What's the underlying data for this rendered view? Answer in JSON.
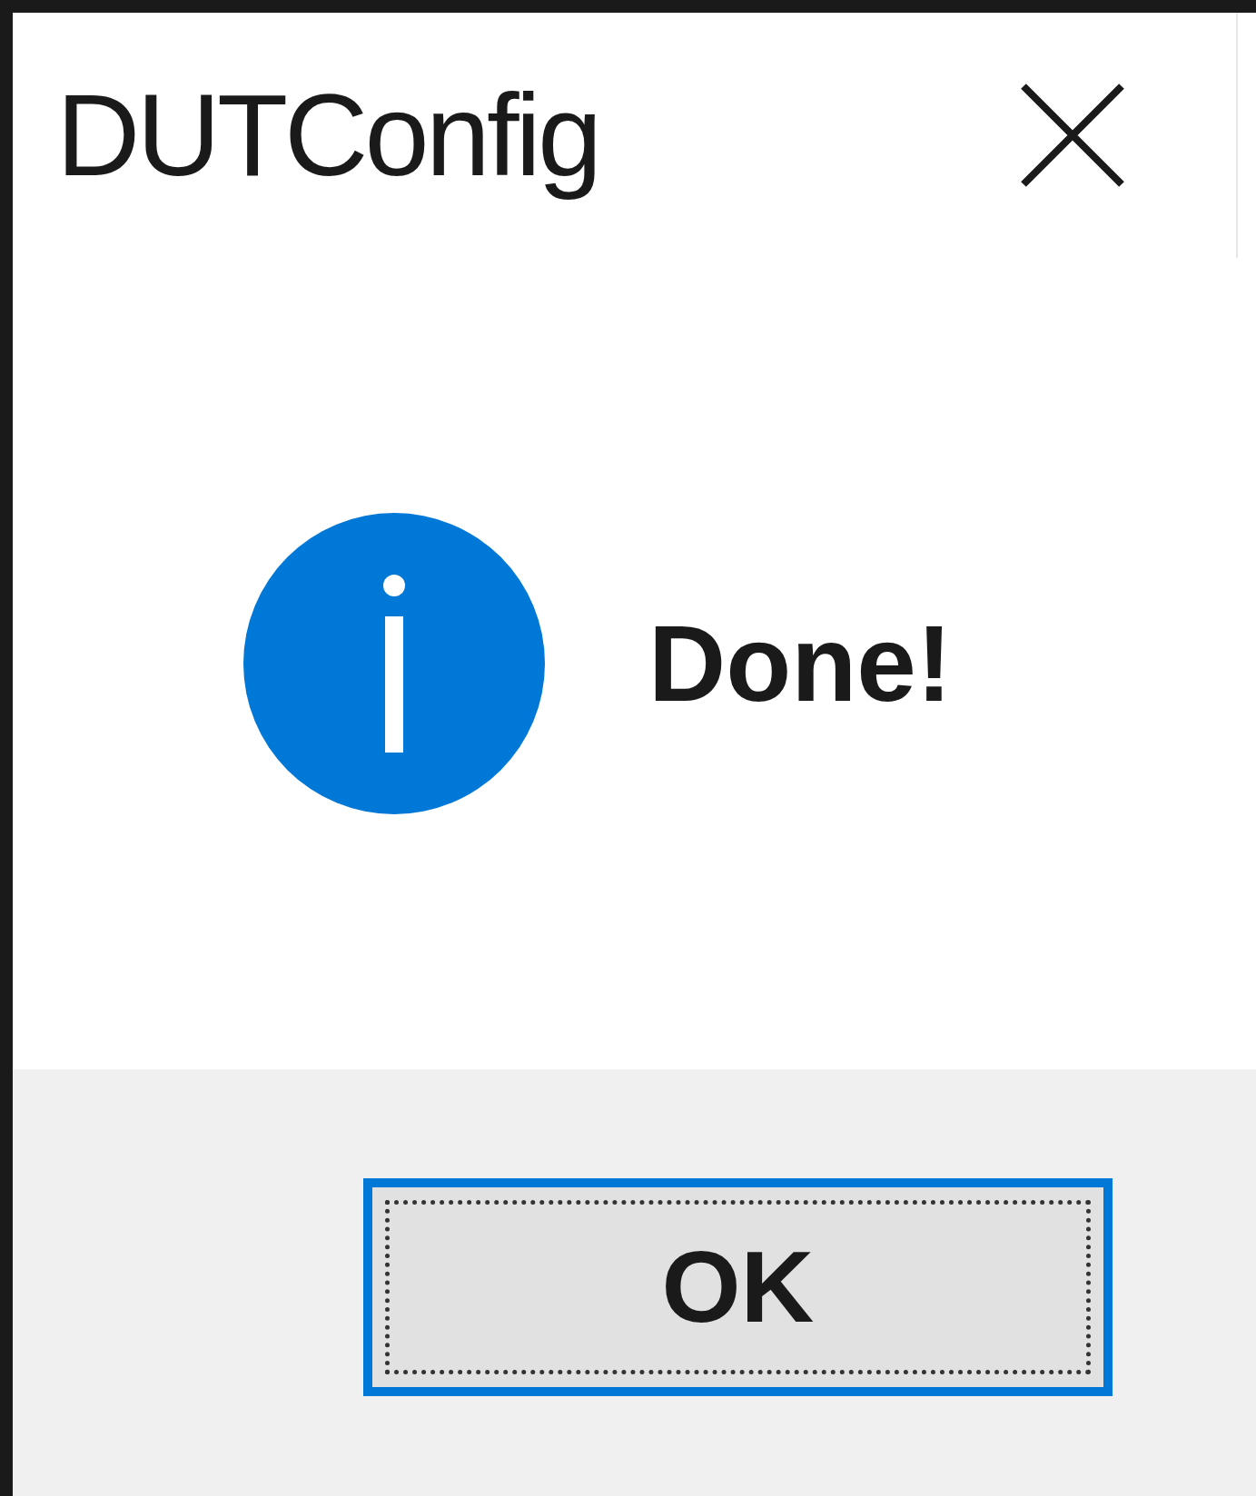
{
  "window": {
    "title": "DUTConfig"
  },
  "message": {
    "text": "Done!"
  },
  "buttons": [
    {
      "label": "OK",
      "focused": true
    }
  ]
}
